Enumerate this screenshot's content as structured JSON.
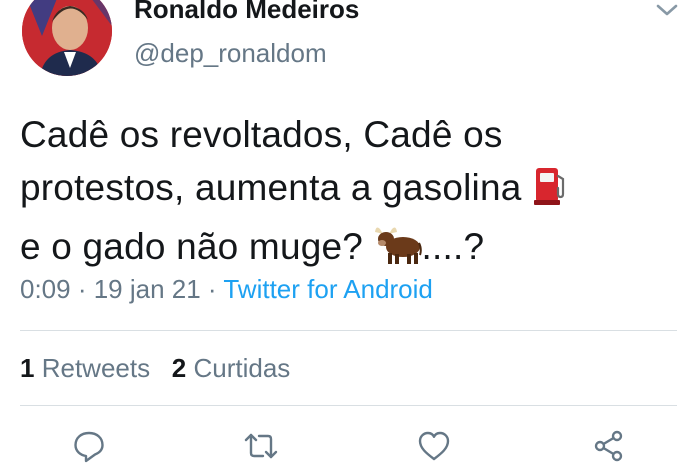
{
  "author": {
    "display_name": "Ronaldo Medeiros",
    "handle": "@dep_ronaldom"
  },
  "tweet": {
    "line1": "Cadê os revoltados, Cadê os",
    "line2": "protestos, aumenta a gasolina",
    "line3_before_emoji": "e o gado não muge?",
    "line3_after_emoji": "....?",
    "emojis": [
      "fuel-pump-icon",
      "ox-icon"
    ]
  },
  "meta": {
    "time": "0:09",
    "separator": " · ",
    "date": "19 jan 21",
    "source": "Twitter for Android"
  },
  "stats": {
    "retweets_count": "1",
    "retweets_label": "Retweets",
    "likes_count": "2",
    "likes_label": "Curtidas"
  },
  "actions": [
    "reply-icon",
    "retweet-icon",
    "like-icon",
    "share-icon"
  ],
  "colors": {
    "text": "#14171a",
    "secondary": "#657786",
    "link": "#1da1f2",
    "divider": "#d9dfe3"
  }
}
